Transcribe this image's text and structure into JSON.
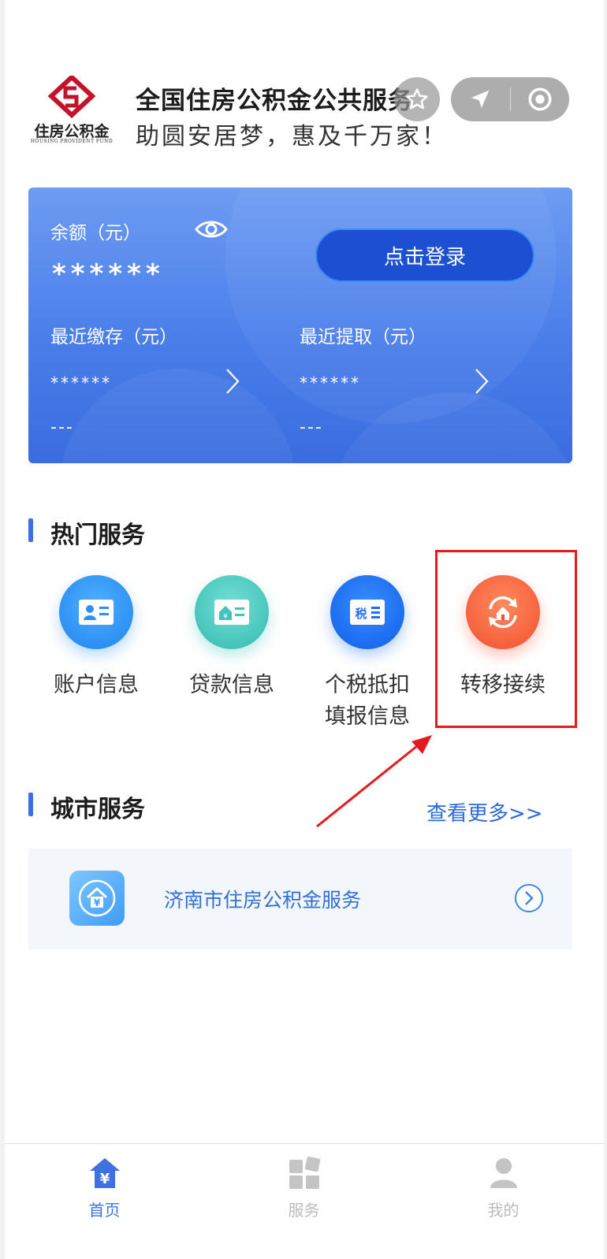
{
  "header": {
    "logo_text": "住房公积金",
    "logo_en": "HOUSING  PROVIDENT  FUND",
    "app_title": "全国住房公积金公共服务",
    "slogan": "助圆安居梦，惠及千万家！"
  },
  "card": {
    "balance_label": "余额（元）",
    "balance_value": "******",
    "recent_deposit_label": "最近缴存（元）",
    "recent_deposit_value": "******",
    "recent_deposit_date": "---",
    "recent_withdraw_label": "最近提取（元）",
    "recent_withdraw_value": "******",
    "recent_withdraw_date": "---",
    "login_button": "点击登录"
  },
  "hot_services": {
    "title": "热门服务",
    "items": [
      {
        "label": "账户信息",
        "icon": "account-card-icon",
        "color": "#2f8ff5"
      },
      {
        "label": "贷款信息",
        "icon": "loan-card-icon",
        "color": "#3fc4bb"
      },
      {
        "label": "个税抵扣填报信息",
        "icon": "tax-card-icon",
        "color": "#1f6ff0"
      },
      {
        "label": "转移接续",
        "icon": "transfer-icon",
        "color": "#f55a3a"
      }
    ]
  },
  "city_services": {
    "title": "城市服务",
    "more_link": "查看更多>>",
    "items": [
      {
        "label": "济南市住房公积金服务",
        "icon": "house-yuan-icon"
      }
    ]
  },
  "tabbar": {
    "items": [
      {
        "label": "首页",
        "icon": "home-yuan-icon",
        "active": true
      },
      {
        "label": "服务",
        "icon": "services-grid-icon",
        "active": false
      },
      {
        "label": "我的",
        "icon": "user-icon",
        "active": false
      }
    ]
  },
  "colors": {
    "accent": "#3d6ee6",
    "highlight_box": "#e5191e",
    "tab_active": "#3f72e0",
    "tab_inactive": "#bbbbbb"
  }
}
